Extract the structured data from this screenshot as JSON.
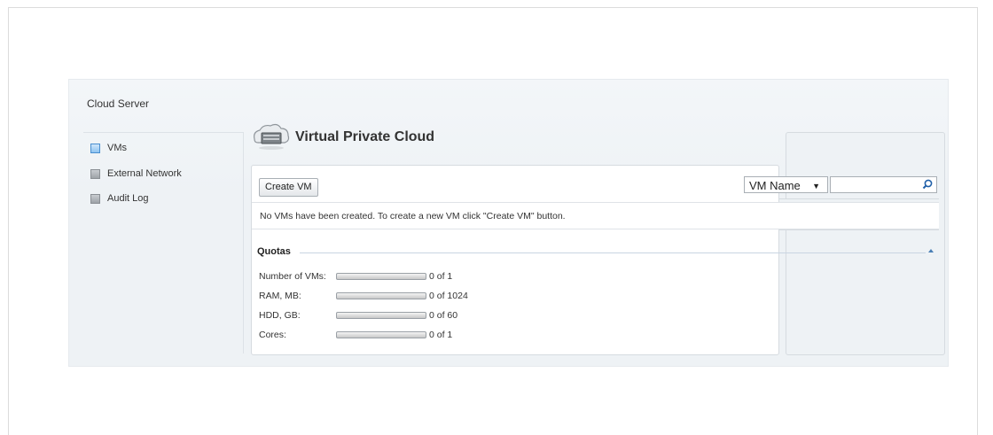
{
  "page": {
    "title_fragment": "Cloud Server",
    "close_label": "X"
  },
  "panel": {
    "header": "Cloud Server"
  },
  "sidebar": {
    "items": [
      {
        "label": "VMs",
        "active": true
      },
      {
        "label": "External Network",
        "active": false
      },
      {
        "label": "Audit Log",
        "active": false
      }
    ]
  },
  "main": {
    "title": "Virtual Private Cloud",
    "icon": "cloud-server-icon",
    "create_button": "Create VM",
    "empty_message": "No VMs have been created. To create a new VM click \"Create VM\" button.",
    "search": {
      "field_selected": "VM Name",
      "caret": "▼",
      "placeholder": ""
    },
    "quotas": {
      "legend": "Quotas",
      "rows": [
        {
          "label": "Number of VMs:",
          "value": "0 of 1",
          "fill_fraction": 0
        },
        {
          "label": "RAM, MB:",
          "value": "0 of 1024",
          "fill_fraction": 0
        },
        {
          "label": "HDD, GB:",
          "value": "0 of 60",
          "fill_fraction": 0
        },
        {
          "label": "Cores:",
          "value": "0 of 1",
          "fill_fraction": 0
        }
      ]
    }
  },
  "colors": {
    "active_item": "#8ec3f0",
    "link_blue": "#4a7fb5"
  }
}
